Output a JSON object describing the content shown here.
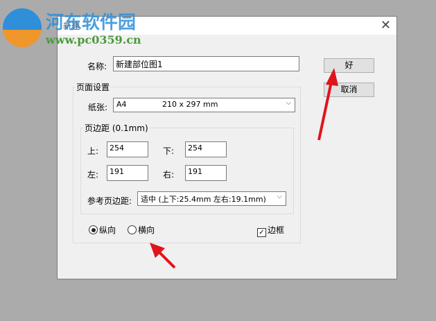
{
  "watermark": {
    "site_name": "河东软件园",
    "url": "www.pc0359.cn"
  },
  "dialog": {
    "title": "新建",
    "name_label": "名称:",
    "name_value": "新建部位图1",
    "ok_label": "好",
    "cancel_label": "取消",
    "page_setup": {
      "legend": "页面设置",
      "paper_label": "纸张:",
      "paper_value": "A4",
      "paper_size": "210 x 297 mm",
      "margins": {
        "legend": "页边距 (0.1mm)",
        "top_label": "上:",
        "top_value": "254",
        "bottom_label": "下:",
        "bottom_value": "254",
        "left_label": "左:",
        "left_value": "191",
        "right_label": "右:",
        "right_value": "191",
        "preset_label": "参考页边距:",
        "preset_value": "适中 (上下:25.4mm 左右:19.1mm)"
      },
      "portrait_label": "纵向",
      "landscape_label": "横向",
      "orientation": "portrait",
      "border_label": "边框",
      "border_checked": true
    }
  },
  "colors": {
    "arrow": "#e0141b"
  }
}
